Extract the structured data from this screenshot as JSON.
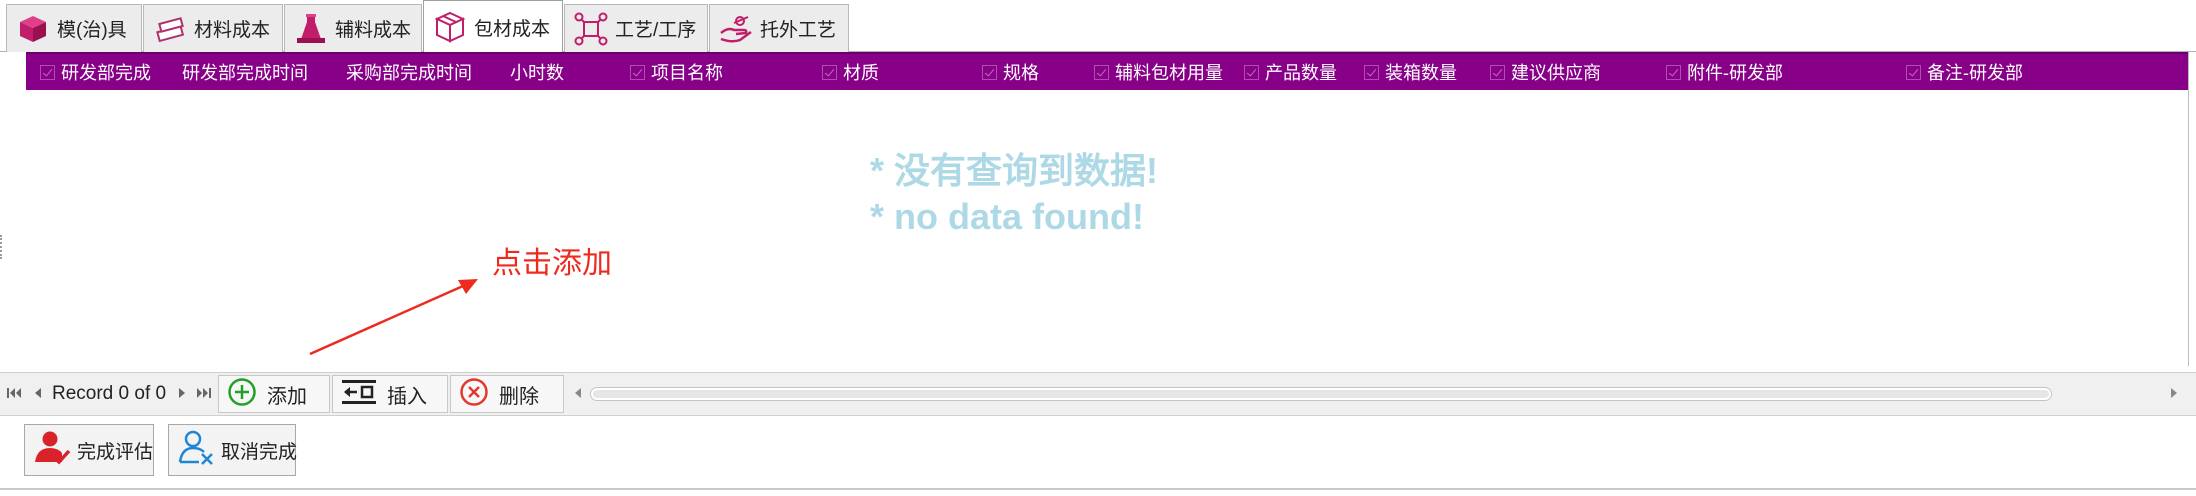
{
  "tabs": [
    {
      "label": "模(治)具",
      "icon": "cube-icon",
      "active": false
    },
    {
      "label": "材料成本",
      "icon": "material-stack-icon",
      "active": false
    },
    {
      "label": "辅料成本",
      "icon": "flask-stack-icon",
      "active": false
    },
    {
      "label": "包材成本",
      "icon": "package-box-icon",
      "active": true
    },
    {
      "label": "工艺/工序",
      "icon": "process-network-icon",
      "active": false
    },
    {
      "label": "托外工艺",
      "icon": "outsource-hand-icon",
      "active": false
    }
  ],
  "grid": {
    "columns": [
      {
        "label": "研发部完成",
        "checkbox": true
      },
      {
        "label": "研发部完成时间",
        "checkbox": false
      },
      {
        "label": "采购部完成时间",
        "checkbox": false
      },
      {
        "label": "小时数",
        "checkbox": false
      },
      {
        "label": "项目名称",
        "checkbox": true
      },
      {
        "label": "材质",
        "checkbox": true
      },
      {
        "label": "规格",
        "checkbox": true
      },
      {
        "label": "辅料包材用量",
        "checkbox": true
      },
      {
        "label": "产品数量",
        "checkbox": true
      },
      {
        "label": "装箱数量",
        "checkbox": true
      },
      {
        "label": "建议供应商",
        "checkbox": true
      },
      {
        "label": "附件-研发部",
        "checkbox": true
      },
      {
        "label": "备注-研发部",
        "checkbox": true
      }
    ],
    "header_color": "#880088",
    "empty_message_cn": "* 没有查询到数据!",
    "empty_message_en": "* no data found!"
  },
  "annotation": {
    "text": "点击添加",
    "color": "#ee2a1f"
  },
  "navigator": {
    "record_text": "Record 0 of 0",
    "add_label": "添加",
    "insert_label": "插入",
    "delete_label": "删除"
  },
  "toolbar": {
    "complete_eval_label": "完成评估",
    "cancel_complete_label": "取消完成"
  }
}
